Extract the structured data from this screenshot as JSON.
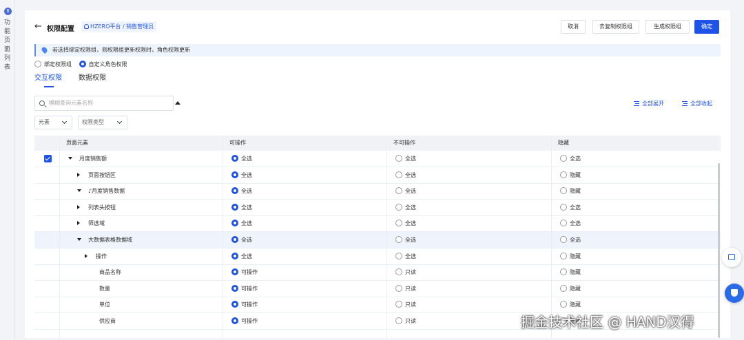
{
  "sidebar": {
    "label": "功能页面列表"
  },
  "header": {
    "back_icon": "arrow-left-icon",
    "title": "权限配置",
    "breadcrumb": "HZERO平台 / 销售管理员",
    "buttons": {
      "cancel": "取消",
      "copy": "去复制权限组",
      "generate": "生成权限组",
      "confirm": "确定"
    }
  },
  "notice": "若选择绑定权限组，则权限组更新权限时，角色权限更新",
  "mode": {
    "options": [
      "绑定权限组",
      "自定义角色权限"
    ],
    "selected": "自定义角色权限"
  },
  "tabs": [
    {
      "label": "交互权限",
      "active": true
    },
    {
      "label": "数据权限",
      "active": false
    }
  ],
  "search": {
    "placeholder": "模糊查询元素名称"
  },
  "actions": {
    "expand_all": "全部展开",
    "collapse_all": "全部收起"
  },
  "filters": {
    "element": "元素",
    "perm_type": "权限类型"
  },
  "table": {
    "headers": [
      "页面元素",
      "可操作",
      "不可操作",
      "隐藏"
    ],
    "rows": [
      {
        "name": "月度销售额",
        "level": 0,
        "toggle": "down",
        "checked": true,
        "op": "全选",
        "noop": "全选",
        "hide": "全选",
        "sel": "op",
        "highlight": false,
        "icon": ""
      },
      {
        "name": "页面按钮区",
        "level": 1,
        "toggle": "right",
        "checked": false,
        "op": "全选",
        "noop": "全选",
        "hide": "隐藏",
        "sel": "op",
        "highlight": false,
        "icon": ""
      },
      {
        "name": "月度销售数据",
        "level": 1,
        "toggle": "down",
        "checked": false,
        "op": "全选",
        "noop": "全选",
        "hide": "隐藏",
        "sel": "op",
        "highlight": false,
        "icon": "music-note-icon"
      },
      {
        "name": "列表头按钮",
        "level": 2,
        "toggle": "right",
        "checked": false,
        "op": "全选",
        "noop": "全选",
        "hide": "全选",
        "sel": "op",
        "highlight": false,
        "icon": ""
      },
      {
        "name": "筛选域",
        "level": 2,
        "toggle": "right",
        "checked": false,
        "op": "全选",
        "noop": "全选",
        "hide": "全选",
        "sel": "op",
        "highlight": false,
        "icon": ""
      },
      {
        "name": "大数据表格数据域",
        "level": 2,
        "toggle": "down",
        "checked": false,
        "op": "全选",
        "noop": "全选",
        "hide": "全选",
        "sel": "op",
        "highlight": true,
        "icon": ""
      },
      {
        "name": "操作",
        "level": 3,
        "toggle": "right",
        "checked": false,
        "op": "全选",
        "noop": "全选",
        "hide": "隐藏",
        "sel": "op",
        "highlight": false,
        "icon": ""
      },
      {
        "name": "商品名称",
        "level": 4,
        "toggle": "",
        "checked": false,
        "op": "可操作",
        "noop": "只读",
        "hide": "隐藏",
        "sel": "op",
        "highlight": false,
        "icon": ""
      },
      {
        "name": "数量",
        "level": 4,
        "toggle": "",
        "checked": false,
        "op": "可操作",
        "noop": "只读",
        "hide": "隐藏",
        "sel": "op",
        "highlight": false,
        "icon": ""
      },
      {
        "name": "单位",
        "level": 4,
        "toggle": "",
        "checked": false,
        "op": "可操作",
        "noop": "只读",
        "hide": "隐藏",
        "sel": "op",
        "highlight": false,
        "icon": ""
      },
      {
        "name": "供应商",
        "level": 4,
        "toggle": "",
        "checked": false,
        "op": "可操作",
        "noop": "只读",
        "hide": "隐藏",
        "sel": "op",
        "highlight": false,
        "icon": ""
      }
    ]
  },
  "watermark": "掘金技术社区 @ HAND汉得"
}
